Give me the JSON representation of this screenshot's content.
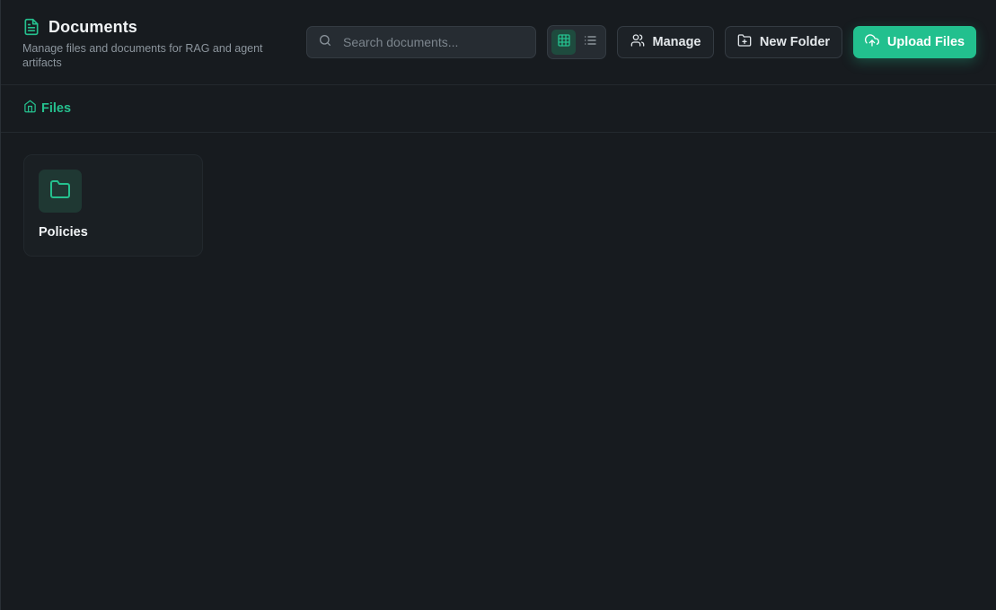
{
  "header": {
    "title": "Documents",
    "subtitle": "Manage files and documents for RAG and agent artifacts",
    "title_icon": "document-icon"
  },
  "search": {
    "placeholder": "Search documents...",
    "value": "",
    "icon": "search-icon"
  },
  "view_toggle": {
    "options": [
      "grid",
      "list"
    ],
    "selected": "grid"
  },
  "toolbar": {
    "manage_label": "Manage",
    "manage_icon": "users-icon",
    "new_folder_label": "New Folder",
    "new_folder_icon": "folder-plus-icon",
    "upload_label": "Upload Files",
    "upload_icon": "cloud-upload-icon"
  },
  "breadcrumb": {
    "items": [
      {
        "label": "Files",
        "icon": "home-icon"
      }
    ]
  },
  "folders": [
    {
      "name": "Policies",
      "icon": "folder-icon"
    }
  ],
  "colors": {
    "accent": "#22c08e",
    "background": "#171b1f",
    "surface": "#262c32"
  }
}
